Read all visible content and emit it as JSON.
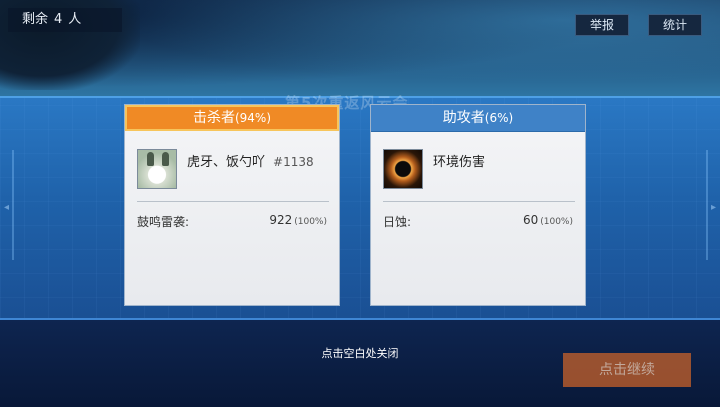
{
  "top": {
    "remaining_label": "剩余",
    "remaining_count": "4",
    "remaining_unit": "人",
    "report_label": "举报",
    "stats_label": "统计"
  },
  "background_title": "第5次重返风云会",
  "killer_card": {
    "header_label": "击杀者",
    "header_pct": "(94%)",
    "player_name": "虎牙、饭勺吖",
    "player_id": "#1138",
    "skill_name": "鼓鸣雷袭:",
    "damage": "922",
    "damage_pct": "(100%)",
    "avatar_icon": "rabbit-avatar",
    "header_color": "#f08a25"
  },
  "assist_card": {
    "header_label": "助攻者",
    "header_pct": "(6%)",
    "player_name": "环境伤害",
    "skill_name": "日蚀:",
    "damage": "60",
    "damage_pct": "(100%)",
    "avatar_icon": "eclipse-icon",
    "header_color": "#3f82c7"
  },
  "close_hint": "点击空白处关闭",
  "continue_label": "点击继续"
}
